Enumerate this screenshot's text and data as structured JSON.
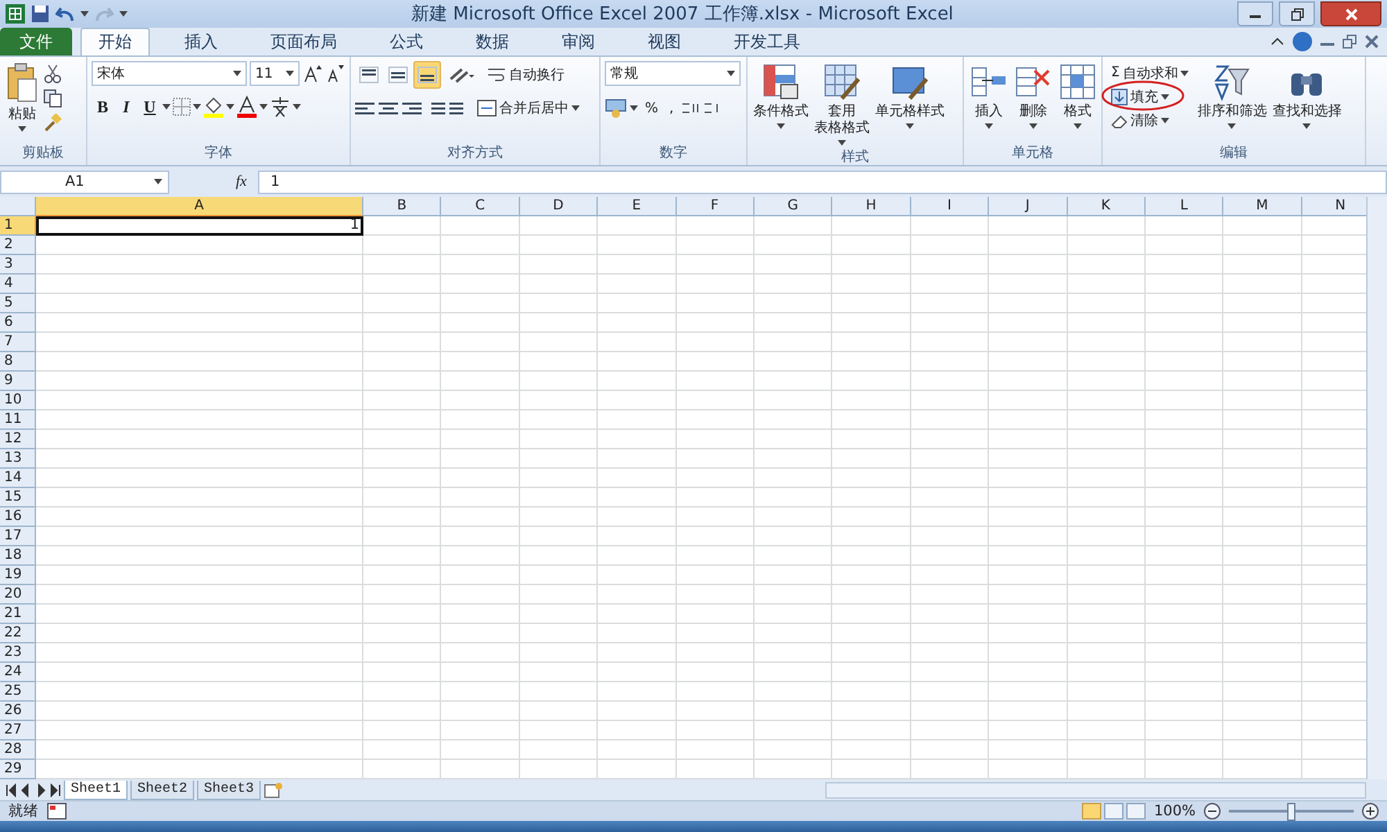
{
  "window": {
    "title": "新建 Microsoft Office Excel 2007 工作簿.xlsx - Microsoft Excel"
  },
  "tabs": [
    {
      "label": "文件",
      "kind": "file",
      "selected": false
    },
    {
      "label": "开始",
      "kind": "tab",
      "selected": true
    },
    {
      "label": "插入",
      "kind": "tab",
      "selected": false
    },
    {
      "label": "页面布局",
      "kind": "tab",
      "selected": false
    },
    {
      "label": "公式",
      "kind": "tab",
      "selected": false
    },
    {
      "label": "数据",
      "kind": "tab",
      "selected": false
    },
    {
      "label": "审阅",
      "kind": "tab",
      "selected": false
    },
    {
      "label": "视图",
      "kind": "tab",
      "selected": false
    },
    {
      "label": "开发工具",
      "kind": "tab",
      "selected": false
    }
  ],
  "ribbon": {
    "clipboard": {
      "label": "剪贴板",
      "paste": "粘贴"
    },
    "font": {
      "label": "字体",
      "font_name": "宋体",
      "font_size": "11",
      "bold": "B",
      "italic": "I",
      "underline": "U"
    },
    "alignment": {
      "label": "对齐方式",
      "vertical": [
        {
          "selected": false
        },
        {
          "selected": false
        },
        {
          "selected": true
        }
      ],
      "wrap": "自动换行",
      "merge": "合并后居中"
    },
    "number": {
      "label": "数字",
      "format": "常规",
      "percent": "%",
      "comma": ","
    },
    "styles": {
      "label": "样式",
      "buttons": [
        {
          "lines": [
            "条件格式"
          ]
        },
        {
          "lines": [
            "套用",
            "表格格式"
          ]
        },
        {
          "lines": [
            "单元格样式"
          ]
        }
      ]
    },
    "cells": {
      "label": "单元格",
      "buttons": [
        "插入",
        "删除",
        "格式"
      ]
    },
    "editing": {
      "label": "编辑",
      "small": [
        {
          "symbol": "Σ",
          "label": "自动求和",
          "circled": false
        },
        {
          "label": "填充",
          "circled": true
        },
        {
          "label": "清除",
          "circled": false
        }
      ],
      "large": [
        "排序和筛选",
        "查找和选择"
      ]
    }
  },
  "formula_bar": {
    "name_box": "A1",
    "function_label": "fx",
    "value": "1"
  },
  "sheet": {
    "columns": [
      {
        "label": "A",
        "selected": true
      },
      {
        "label": "B",
        "selected": false
      },
      {
        "label": "C",
        "selected": false
      },
      {
        "label": "D",
        "selected": false
      },
      {
        "label": "E",
        "selected": false
      },
      {
        "label": "F",
        "selected": false
      },
      {
        "label": "G",
        "selected": false
      },
      {
        "label": "H",
        "selected": false
      },
      {
        "label": "I",
        "selected": false
      },
      {
        "label": "J",
        "selected": false
      },
      {
        "label": "K",
        "selected": false
      },
      {
        "label": "L",
        "selected": false
      },
      {
        "label": "M",
        "selected": false
      },
      {
        "label": "N",
        "selected": false
      }
    ],
    "rows": [
      {
        "header": "1",
        "selected": true,
        "cells": [
          {
            "value": "1",
            "selected": true
          }
        ]
      },
      {
        "header": "2",
        "selected": false
      },
      {
        "header": "3",
        "selected": false
      },
      {
        "header": "4",
        "selected": false
      },
      {
        "header": "5",
        "selected": false
      },
      {
        "header": "6",
        "selected": false
      },
      {
        "header": "7",
        "selected": false
      },
      {
        "header": "8",
        "selected": false
      },
      {
        "header": "9",
        "selected": false
      },
      {
        "header": "10",
        "selected": false
      },
      {
        "header": "11",
        "selected": false
      },
      {
        "header": "12",
        "selected": false
      },
      {
        "header": "13",
        "selected": false
      },
      {
        "header": "14",
        "selected": false
      },
      {
        "header": "15",
        "selected": false
      },
      {
        "header": "16",
        "selected": false
      },
      {
        "header": "17",
        "selected": false
      },
      {
        "header": "18",
        "selected": false
      },
      {
        "header": "19",
        "selected": false
      },
      {
        "header": "20",
        "selected": false
      },
      {
        "header": "21",
        "selected": false
      },
      {
        "header": "22",
        "selected": false
      },
      {
        "header": "23",
        "selected": false
      },
      {
        "header": "24",
        "selected": false
      },
      {
        "header": "25",
        "selected": false
      },
      {
        "header": "26",
        "selected": false
      },
      {
        "header": "27",
        "selected": false
      },
      {
        "header": "28",
        "selected": false
      },
      {
        "header": "29",
        "selected": false
      }
    ]
  },
  "sheet_tabs": [
    {
      "label": "Sheet1",
      "selected": true
    },
    {
      "label": "Sheet2",
      "selected": false
    },
    {
      "label": "Sheet3",
      "selected": false
    }
  ],
  "status_bar": {
    "text": "就绪",
    "views": [
      {
        "selected": true
      },
      {
        "selected": false
      },
      {
        "selected": false
      }
    ],
    "zoom": {
      "reading": "100%",
      "level": 0.5
    }
  }
}
